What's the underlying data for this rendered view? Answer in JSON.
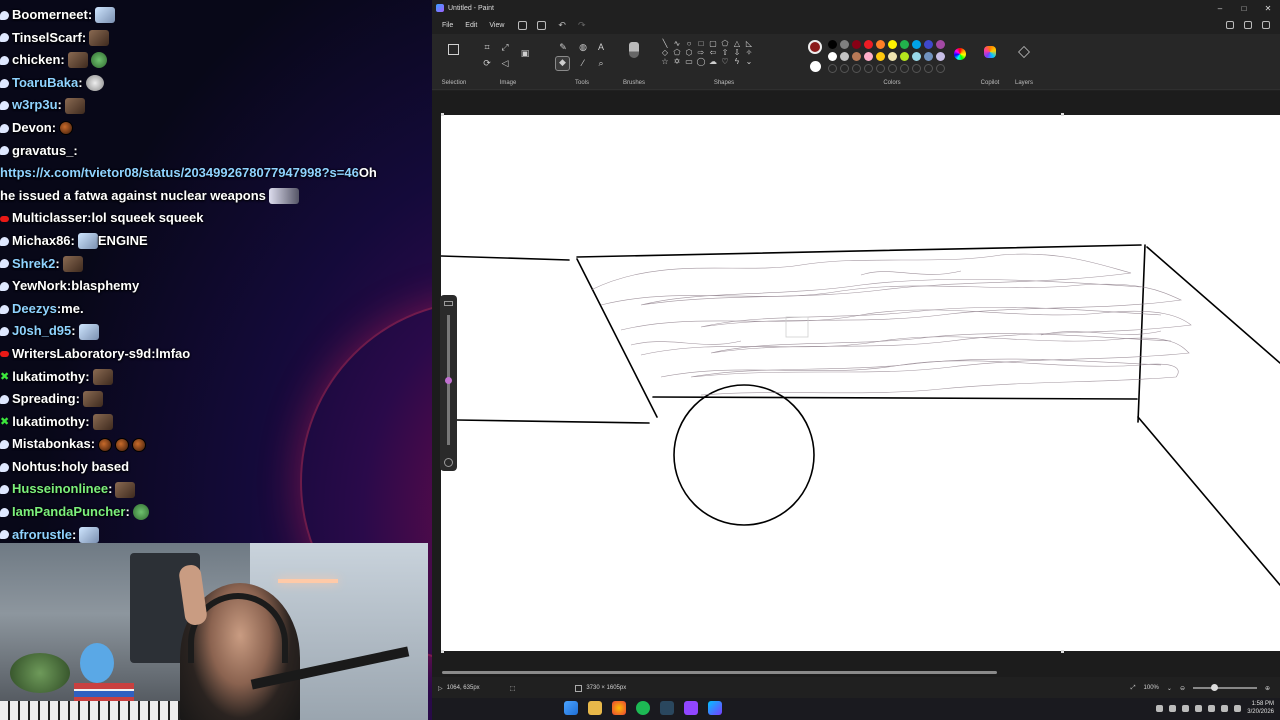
{
  "chat": {
    "lines": [
      {
        "user": "Boomerneet",
        "sep": ":",
        "text": ""
      },
      {
        "user": "TinselScarf",
        "sep": ":",
        "text": ""
      },
      {
        "user": "chicken",
        "sep": ":",
        "text": ""
      },
      {
        "user": "ToaruBaka",
        "sep": ":",
        "text": ""
      },
      {
        "user": "w3rp3u",
        "sep": ":",
        "text": ""
      },
      {
        "user": "Devon",
        "sep": ":",
        "text": ""
      },
      {
        "user": "gravatus_",
        "sep": ":",
        "text": ""
      },
      {
        "link": "https://x.com/tvietor08/status/2034992678077947998?s=46",
        "text": " Oh"
      },
      {
        "text": "he issued a fatwa against nuclear weapons"
      },
      {
        "user": "Multiclasser",
        "sep": ":",
        "text": "lol squeek squeek"
      },
      {
        "user": "Michax86",
        "sep": ":",
        "text": " ENGINE"
      },
      {
        "user": "Shrek2",
        "sep": ":",
        "text": ""
      },
      {
        "user": "YewNork",
        "sep": ":",
        "text": "blasphemy"
      },
      {
        "user": "Deezys",
        "sep": ":",
        "text": "me."
      },
      {
        "user": "J0sh_d95",
        "sep": ":",
        "text": ""
      },
      {
        "user": "WritersLaboratory-s9d",
        "sep": ":",
        "text": "lmfao"
      },
      {
        "user": "lukatimothy",
        "sep": ":",
        "text": ""
      },
      {
        "user": "Spreading",
        "sep": ":",
        "text": ""
      },
      {
        "user": "lukatimothy",
        "sep": ":",
        "text": ""
      },
      {
        "user": "Mistabonkas",
        "sep": ":",
        "text": ""
      },
      {
        "user": "Nohtus",
        "sep": ":",
        "text": "holy based"
      },
      {
        "user": "Husseinonlinee",
        "sep": ":",
        "text": ""
      },
      {
        "user": "IamPandaPuncher",
        "sep": ":",
        "text": ""
      },
      {
        "user": "afrorustle",
        "sep": ":",
        "text": ""
      }
    ]
  },
  "paint": {
    "window_title": "Untitled - Paint",
    "window_controls": {
      "minimize": "–",
      "maximize": "□",
      "close": "✕"
    },
    "menu": {
      "file": "File",
      "edit": "Edit",
      "view": "View"
    },
    "ribbon": {
      "selection": "Selection",
      "image": "Image",
      "tools": "Tools",
      "brushes": "Brushes",
      "shapes": "Shapes",
      "colors": "Colors",
      "copilot": "Copilot",
      "layers": "Layers"
    },
    "colors": {
      "primary": "#8b1a1a",
      "secondary": "#ffffff",
      "row1": [
        "#000000",
        "#7f7f7f",
        "#880015",
        "#ed1c24",
        "#ff7f27",
        "#fff200",
        "#22b14c",
        "#00a2e8",
        "#3f48cc",
        "#a349a4"
      ],
      "row2": [
        "#ffffff",
        "#c3c3c3",
        "#b97a57",
        "#ffaec9",
        "#ffc90e",
        "#efe4b0",
        "#b5e61d",
        "#99d9ea",
        "#7092be",
        "#c8bfe7"
      ]
    },
    "status": {
      "cursor": "1064, 635px",
      "canvas_size": "3730 × 1605px",
      "zoom": "100%"
    }
  },
  "taskbar": {
    "time": "1:58 PM",
    "date": "3/20/2026"
  }
}
